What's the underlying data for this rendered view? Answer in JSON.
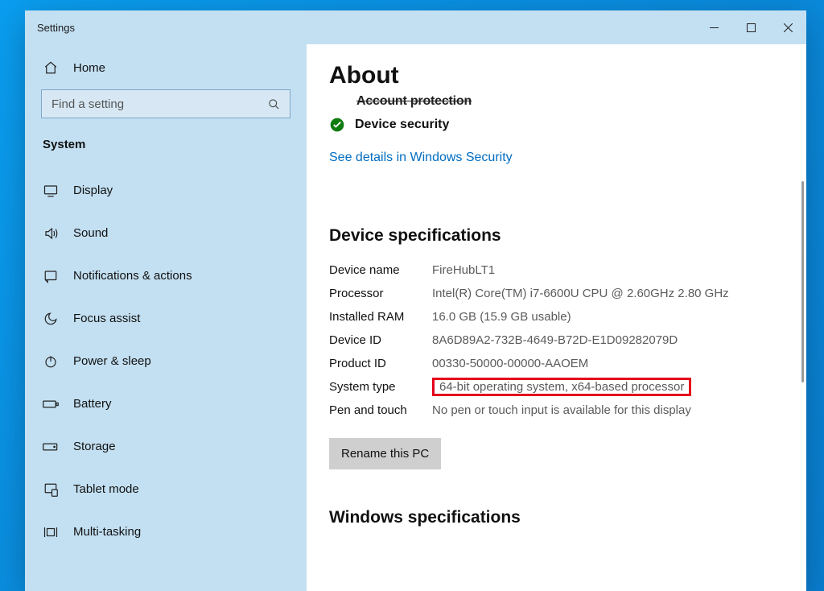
{
  "window": {
    "title": "Settings"
  },
  "sidebar": {
    "home_label": "Home",
    "search_placeholder": "Find a setting",
    "category_label": "System",
    "items": [
      {
        "label": "Display"
      },
      {
        "label": "Sound"
      },
      {
        "label": "Notifications & actions"
      },
      {
        "label": "Focus assist"
      },
      {
        "label": "Power & sleep"
      },
      {
        "label": "Battery"
      },
      {
        "label": "Storage"
      },
      {
        "label": "Tablet mode"
      },
      {
        "label": "Multi-tasking"
      }
    ]
  },
  "content": {
    "page_title": "About",
    "security_clipped_label": "Account protection",
    "security_item_label": "Device security",
    "security_link": "See details in Windows Security",
    "device_spec_heading": "Device specifications",
    "specs": {
      "device_name_label": "Device name",
      "device_name_value": "FireHubLT1",
      "processor_label": "Processor",
      "processor_value": "Intel(R) Core(TM) i7-6600U CPU @ 2.60GHz   2.80 GHz",
      "ram_label": "Installed RAM",
      "ram_value": "16.0 GB (15.9 GB usable)",
      "device_id_label": "Device ID",
      "device_id_value": "8A6D89A2-732B-4649-B72D-E1D09282079D",
      "product_id_label": "Product ID",
      "product_id_value": "00330-50000-00000-AAOEM",
      "system_type_label": "System type",
      "system_type_value": "64-bit operating system, x64-based processor",
      "pen_touch_label": "Pen and touch",
      "pen_touch_value": "No pen or touch input is available for this display"
    },
    "rename_button": "Rename this PC",
    "windows_spec_heading": "Windows specifications"
  }
}
